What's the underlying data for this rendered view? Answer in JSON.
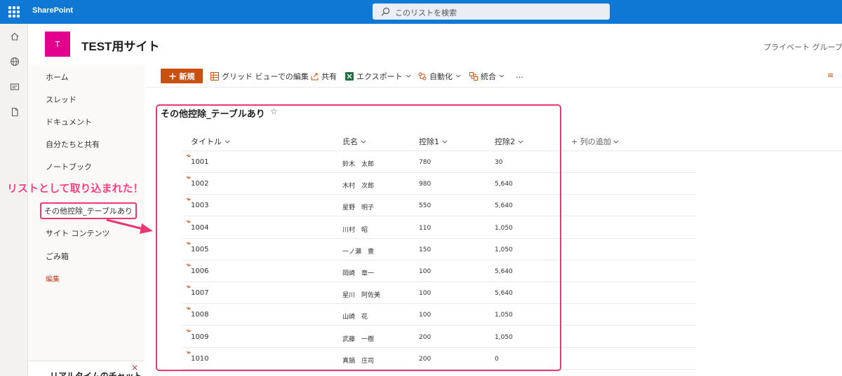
{
  "suite": {
    "brand": "SharePoint",
    "search_placeholder": "このリストを検索"
  },
  "site": {
    "logo_letter": "T",
    "title": "TEST用サイト",
    "privacy": "プライベート グループ"
  },
  "left_nav": {
    "items": [
      "ホーム",
      "スレッド",
      "ドキュメント",
      "自分たちと共有",
      "ノートブック",
      "その他控除_テーブルあり",
      "サイト コンテンツ",
      "ごみ箱"
    ],
    "edit": "編集",
    "chat_title": "リアルタイムのチャット",
    "chat_close": "×"
  },
  "command_bar": {
    "new": "新規",
    "grid_edit": "グリッド ビューでの編集",
    "share": "共有",
    "export": "エクスポート",
    "automate": "自動化",
    "integrate": "統合",
    "more": "…",
    "right_icon": "≡"
  },
  "list": {
    "title": "その他控除_テーブルあり",
    "favorite": "☆",
    "columns": [
      "タイトル",
      "氏名",
      "控除1",
      "控除2"
    ],
    "add_column": "列の追加",
    "rows": [
      {
        "title": "1001",
        "name": "鈴木　太郎",
        "d1": "780",
        "d2": "30"
      },
      {
        "title": "1002",
        "name": "木村　次郎",
        "d1": "980",
        "d2": "5,640"
      },
      {
        "title": "1003",
        "name": "星野　明子",
        "d1": "550",
        "d2": "5,640"
      },
      {
        "title": "1004",
        "name": "川村　昭",
        "d1": "110",
        "d2": "1,050"
      },
      {
        "title": "1005",
        "name": "一ノ瀬　豊",
        "d1": "150",
        "d2": "1,050"
      },
      {
        "title": "1006",
        "name": "岡崎　章一",
        "d1": "100",
        "d2": "5,640"
      },
      {
        "title": "1007",
        "name": "星川　阿佐美",
        "d1": "100",
        "d2": "5,640"
      },
      {
        "title": "1008",
        "name": "山崎　花",
        "d1": "100",
        "d2": "1,050"
      },
      {
        "title": "1009",
        "name": "武藤　一樹",
        "d1": "200",
        "d2": "1,050"
      },
      {
        "title": "1010",
        "name": "真鍋　庄司",
        "d1": "200",
        "d2": "0"
      }
    ]
  },
  "annotation": {
    "text": "リストとして取り込まれた！"
  },
  "colors": {
    "suite_bar": "#0f78d4",
    "accent": "#ca5010",
    "site_logo": "#e3008c",
    "annotation": "#ea3876"
  }
}
